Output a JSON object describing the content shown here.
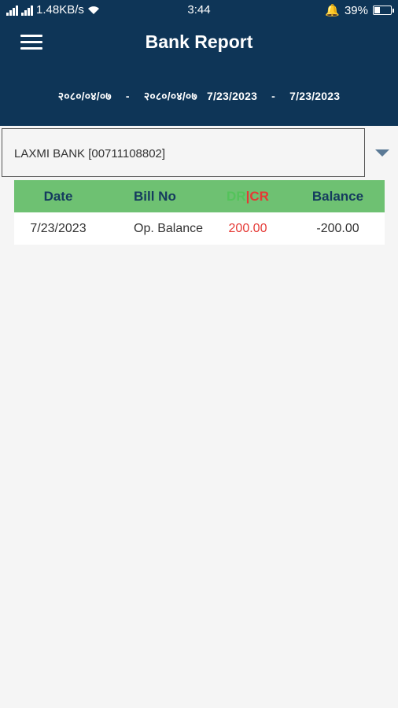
{
  "status_bar": {
    "speed": "1.48KB/s",
    "time": "3:44",
    "battery": "39%"
  },
  "header": {
    "title": "Bank Report",
    "date_from_nepali": "२०८०/०४/०७",
    "date_to_nepali": "२०८०/०४/०७",
    "date_from": "7/23/2023",
    "date_to": "7/23/2023",
    "separator": "-"
  },
  "bank_selector": {
    "selected": "LAXMI BANK [00711108802]"
  },
  "table": {
    "headers": {
      "date": "Date",
      "bill_no": "Bill No",
      "dr": "DR",
      "dr_cr_separator": "|",
      "cr": "CR",
      "balance": "Balance"
    },
    "rows": [
      {
        "date": "7/23/2023",
        "bill_no": "Op. Balance",
        "amount": "200.00",
        "balance": "-200.00"
      }
    ]
  },
  "colors": {
    "appbar": "#0e3557",
    "table_header": "#6ec172",
    "dr": "#54c35b",
    "cr": "#e53935"
  }
}
